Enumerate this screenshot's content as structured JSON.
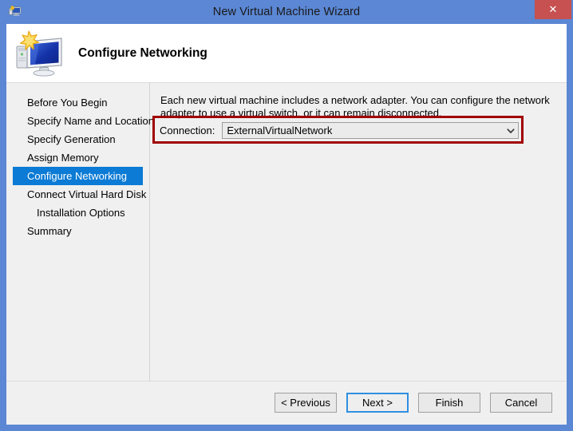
{
  "window": {
    "title": "New Virtual Machine Wizard",
    "icon": "vm-wizard-icon",
    "close_label": "✕"
  },
  "header": {
    "title": "Configure Networking",
    "icon": "computer-monitor-icon"
  },
  "sidebar": {
    "items": [
      {
        "label": "Before You Begin",
        "selected": false,
        "indent": false
      },
      {
        "label": "Specify Name and Location",
        "selected": false,
        "indent": false
      },
      {
        "label": "Specify Generation",
        "selected": false,
        "indent": false
      },
      {
        "label": "Assign Memory",
        "selected": false,
        "indent": false
      },
      {
        "label": "Configure Networking",
        "selected": true,
        "indent": false
      },
      {
        "label": "Connect Virtual Hard Disk",
        "selected": false,
        "indent": false
      },
      {
        "label": "Installation Options",
        "selected": false,
        "indent": true
      },
      {
        "label": "Summary",
        "selected": false,
        "indent": false
      }
    ]
  },
  "main": {
    "description": "Each new virtual machine includes a network adapter. You can configure the network adapter to use a virtual switch, or it can remain disconnected.",
    "connection_label": "Connection:",
    "connection_value": "ExternalVirtualNetwork",
    "connection_options": [
      "ExternalVirtualNetwork"
    ],
    "dropdown_arrow": "⌄",
    "highlight_color": "#a00000"
  },
  "footer": {
    "buttons": [
      {
        "label": "< Previous",
        "default": false
      },
      {
        "label": "Next >",
        "default": true
      },
      {
        "label": "Finish",
        "default": false
      },
      {
        "label": "Cancel",
        "default": false
      }
    ]
  },
  "colors": {
    "titlebar": "#5b87d4",
    "accent": "#0b7bd5",
    "close": "#c75050",
    "body": "#f0f0f0",
    "highlight": "#a00000"
  }
}
